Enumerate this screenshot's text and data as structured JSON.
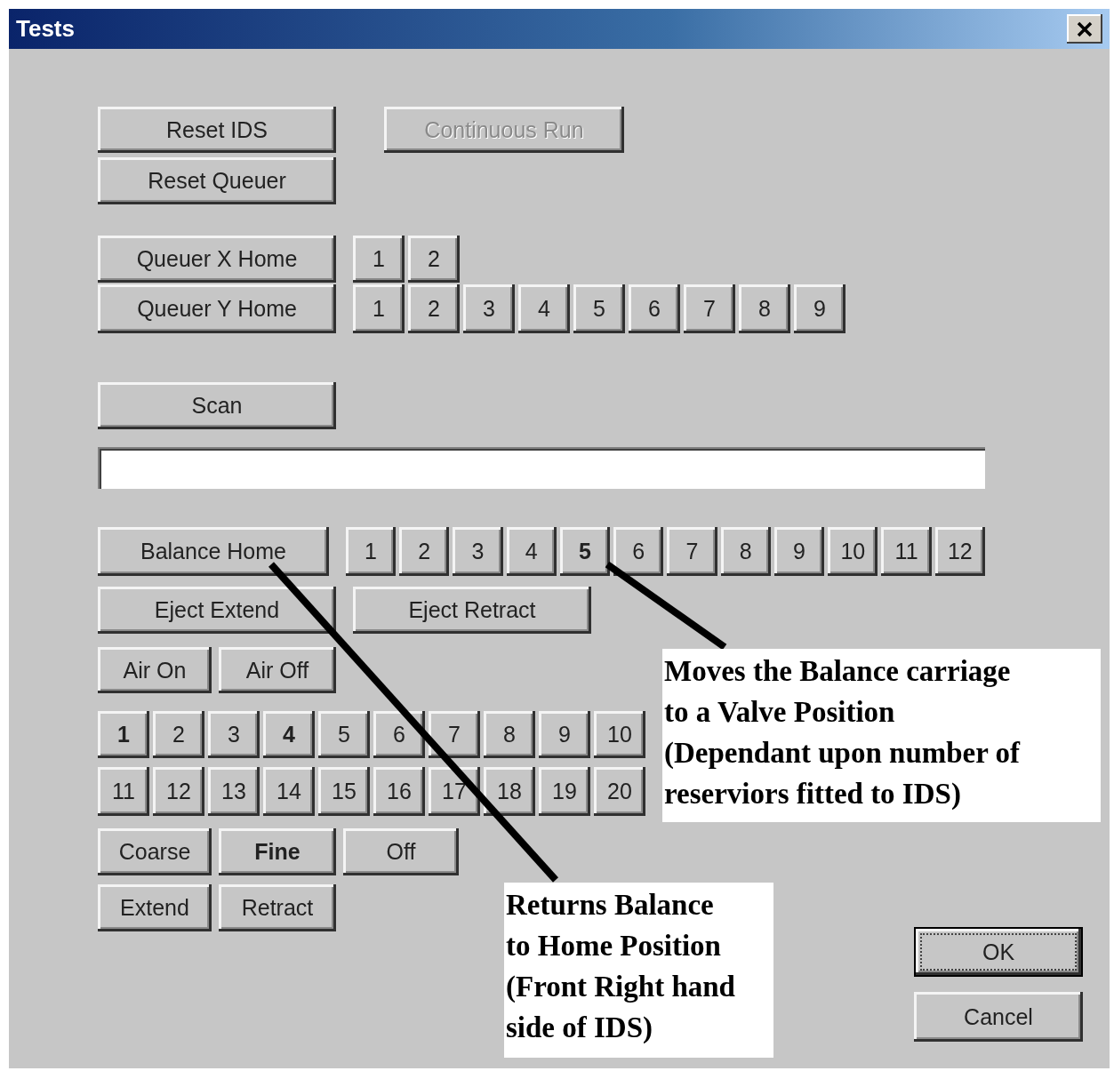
{
  "window": {
    "title": "Tests"
  },
  "controls": {
    "reset_ids": {
      "label": "Reset IDS"
    },
    "continuous_run": {
      "label": "Continuous Run",
      "disabled": true
    },
    "reset_queuer": {
      "label": "Reset Queuer"
    },
    "queuer_x": {
      "label": "Queuer X Home",
      "positions": [
        {
          "label": "1",
          "selected": false
        },
        {
          "label": "2",
          "selected": false
        }
      ]
    },
    "queuer_y": {
      "label": "Queuer Y Home",
      "positions": [
        {
          "label": "1",
          "selected": false
        },
        {
          "label": "2",
          "selected": false
        },
        {
          "label": "3",
          "selected": false
        },
        {
          "label": "4",
          "selected": false
        },
        {
          "label": "5",
          "selected": false
        },
        {
          "label": "6",
          "selected": false
        },
        {
          "label": "7",
          "selected": false
        },
        {
          "label": "8",
          "selected": false
        },
        {
          "label": "9",
          "selected": false
        }
      ]
    },
    "scan": {
      "label": "Scan"
    },
    "balance": {
      "label": "Balance Home",
      "positions": [
        {
          "label": "1",
          "selected": false
        },
        {
          "label": "2",
          "selected": false
        },
        {
          "label": "3",
          "selected": false
        },
        {
          "label": "4",
          "selected": false
        },
        {
          "label": "5",
          "selected": true
        },
        {
          "label": "6",
          "selected": false
        },
        {
          "label": "7",
          "selected": false
        },
        {
          "label": "8",
          "selected": false
        },
        {
          "label": "9",
          "selected": false
        },
        {
          "label": "10",
          "selected": false
        },
        {
          "label": "11",
          "selected": false
        },
        {
          "label": "12",
          "selected": false
        }
      ]
    },
    "eject": [
      "Eject Extend",
      "Eject Retract"
    ],
    "air": [
      "Air On",
      "Air Off"
    ],
    "valves": [
      {
        "label": "1",
        "selected": true
      },
      {
        "label": "2",
        "selected": false
      },
      {
        "label": "3",
        "selected": false
      },
      {
        "label": "4",
        "selected": true
      },
      {
        "label": "5",
        "selected": false
      },
      {
        "label": "6",
        "selected": false
      },
      {
        "label": "7",
        "selected": false
      },
      {
        "label": "8",
        "selected": false
      },
      {
        "label": "9",
        "selected": false
      },
      {
        "label": "10",
        "selected": false
      },
      {
        "label": "11",
        "selected": false
      },
      {
        "label": "12",
        "selected": false
      },
      {
        "label": "13",
        "selected": false
      },
      {
        "label": "14",
        "selected": false
      },
      {
        "label": "15",
        "selected": false
      },
      {
        "label": "16",
        "selected": false
      },
      {
        "label": "17",
        "selected": false
      },
      {
        "label": "18",
        "selected": false
      },
      {
        "label": "19",
        "selected": false
      },
      {
        "label": "20",
        "selected": false
      }
    ],
    "mode": [
      {
        "label": "Coarse",
        "selected": false
      },
      {
        "label": "Fine",
        "selected": true
      },
      {
        "label": "Off",
        "selected": false
      }
    ],
    "motion": [
      "Extend",
      "Retract"
    ]
  },
  "buttons": [
    {
      "label": "OK",
      "default": true
    },
    {
      "label": "Cancel",
      "default": false
    }
  ],
  "callouts": [
    {
      "lines": [
        "Moves the Balance carriage",
        "to a Valve Position",
        "(Dependant upon number of",
        "reserviors fitted to IDS)"
      ]
    },
    {
      "lines": [
        "Returns Balance",
        "to Home Position",
        "(Front Right hand",
        "side of IDS)"
      ]
    }
  ]
}
